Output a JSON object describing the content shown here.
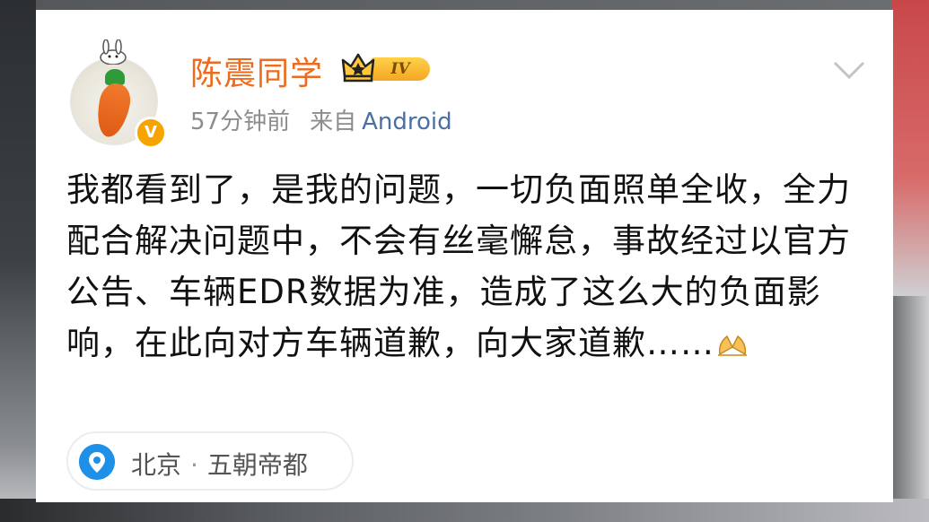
{
  "post": {
    "username": "陈震同学",
    "level_badge": "IV",
    "verified_mark": "V",
    "time_ago": "57分钟前",
    "source_prefix": "来自",
    "source_client": "Android",
    "content_text": "我都看到了，是我的问题，一切负面照单全收，全力配合解决问题中，不会有丝毫懈怠，事故经过以官方公告、车辆EDR数据为准，造成了这么大的负面影响，在此向对方车辆道歉，向大家道歉……",
    "location_city": "北京",
    "location_separator": "·",
    "location_name": "五朝帝都"
  },
  "icons": {
    "avatar": "carrot-bunny-avatar",
    "verified": "verified-badge-icon",
    "crown": "crown-icon",
    "expand": "chevron-down-icon",
    "emoji": "pleading-hands-emoji",
    "location": "location-pin-icon"
  },
  "colors": {
    "username": "#ee6b1e",
    "client_link": "#4a6fa5",
    "verified_badge": "#f6a400",
    "location_pin": "#1e90e8"
  }
}
